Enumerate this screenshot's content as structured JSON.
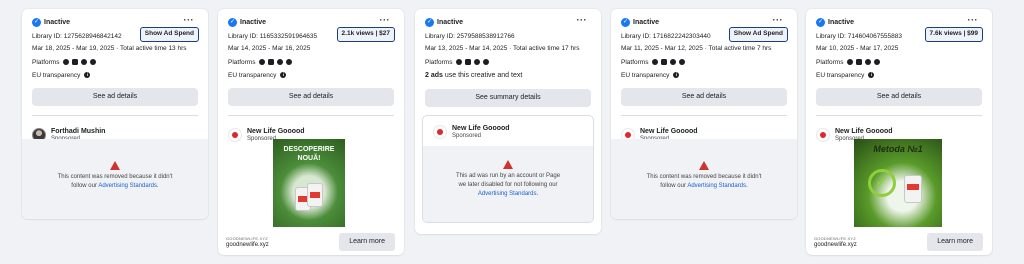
{
  "cards": [
    {
      "status": "Inactive",
      "library_id": "Library ID: 1275628946842142",
      "spend_button": "Show Ad Spend",
      "dates": "Mar 18, 2025 - Mar 19, 2025 · Total active time 13 hrs",
      "platforms_label": "Platforms",
      "eu_label": "EU transparency",
      "details_button": "See ad details",
      "advertiser": "Forthadi Mushin",
      "sponsored": "Sponsored",
      "removed_line1": "This content was removed because it didn't",
      "removed_line2_prefix": "follow our ",
      "removed_link": "Advertising Standards",
      "removed_suffix": "."
    },
    {
      "status": "Inactive",
      "library_id": "Library ID: 1165332591964635",
      "spend_button": "2.1k views | $27",
      "dates": "Mar 14, 2025 - Mar 16, 2025",
      "platforms_label": "Platforms",
      "eu_label": "EU transparency",
      "details_button": "See ad details",
      "advertiser": "New Life Gooood",
      "sponsored": "Sponsored",
      "creative_headline": "DESCOPERIRE NOUĂ!",
      "domain_caption": "GOODNEWLIFE.XYZ",
      "domain_url": "goodnewlife.xyz",
      "cta": "Learn more"
    },
    {
      "status": "Inactive",
      "library_id": "Library ID: 2579588538912766",
      "dates": "Mar 13, 2025 - Mar 14, 2025 · Total active time 17 hrs",
      "multi_count": "2 ads",
      "multi_text": " use this creative and text",
      "details_button": "See summary details",
      "advertiser": "New Life Gooood",
      "sponsored": "Sponsored",
      "removed_line1": "This ad was run by an account or Page",
      "removed_line2": "we later disabled for not following our",
      "removed_link": "Advertising Standards",
      "removed_suffix": "."
    },
    {
      "status": "Inactive",
      "library_id": "Library ID: 1716822242303440",
      "spend_button": "Show Ad Spend",
      "dates": "Mar 11, 2025 - Mar 12, 2025 · Total active time 7 hrs",
      "platforms_label": "Platforms",
      "eu_label": "EU transparency",
      "details_button": "See ad details",
      "advertiser": "New Life Gooood",
      "sponsored": "Sponsored",
      "removed_line1": "This content was removed because it didn't",
      "removed_line2_prefix": "follow our ",
      "removed_link": "Advertising Standards",
      "removed_suffix": "."
    },
    {
      "status": "Inactive",
      "library_id": "Library ID: 714604067555883",
      "spend_button": "7.6k views | $99",
      "dates": "Mar 10, 2025 - Mar 17, 2025",
      "platforms_label": "Platforms",
      "eu_label": "EU transparency",
      "details_button": "See ad details",
      "advertiser": "New Life Gooood",
      "sponsored": "Sponsored",
      "creative_headline": "Metoda №1",
      "domain_caption": "GOODNEWLIFE.XYZ",
      "domain_url": "goodnewlife.xyz",
      "cta": "Learn more"
    }
  ],
  "icons": {
    "status": "check-circle-icon",
    "more": "more-dots-icon",
    "platforms": [
      "facebook-icon",
      "instagram-icon",
      "audience-network-icon",
      "messenger-icon"
    ],
    "eu": "info-icon",
    "warning": "warning-icon"
  },
  "colors": {
    "accent": "#1877f2",
    "warning": "#d0332e",
    "link": "#1a5fd0"
  }
}
